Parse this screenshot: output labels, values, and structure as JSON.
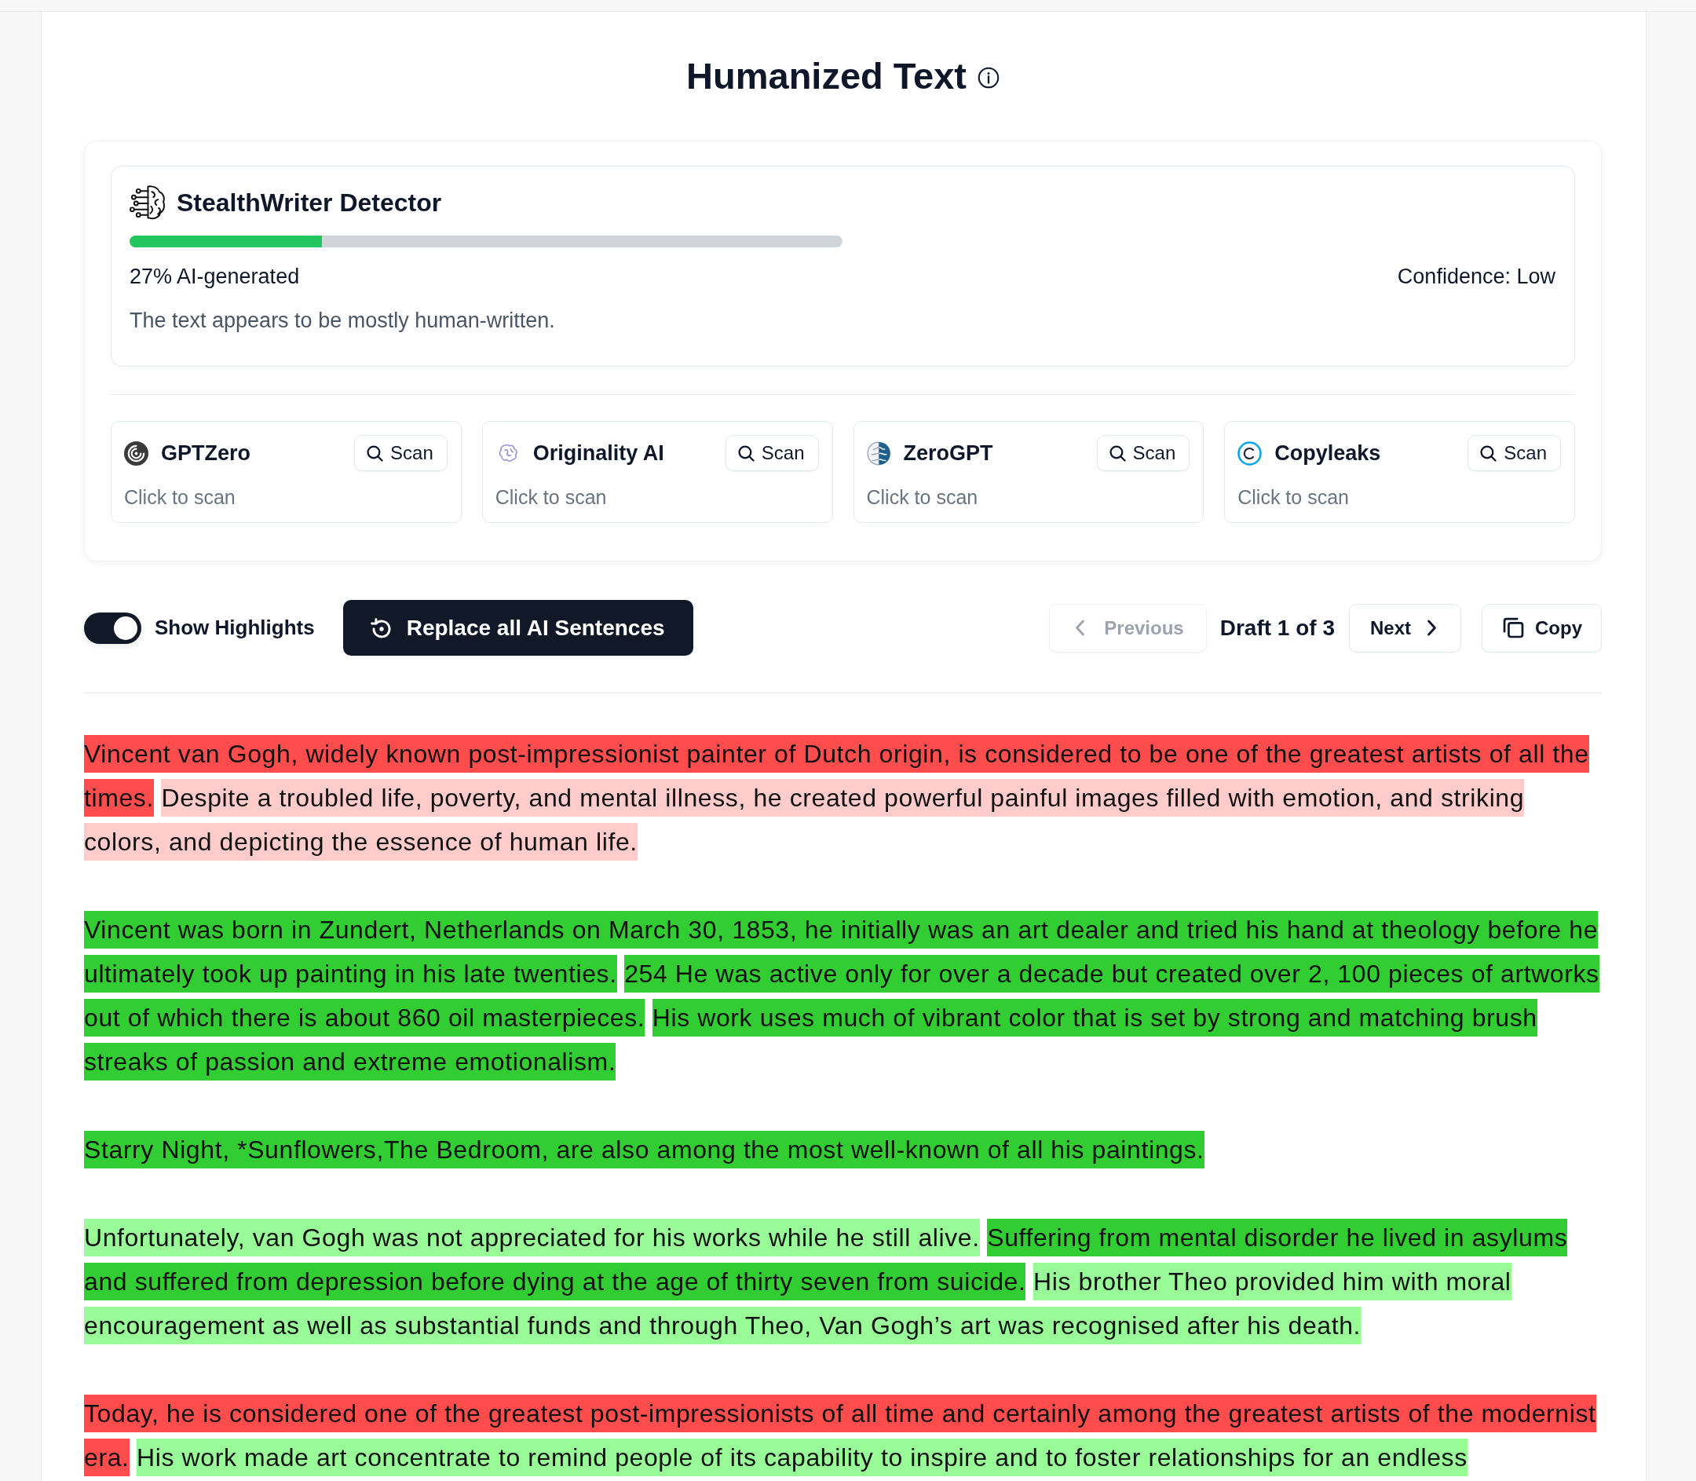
{
  "title": {
    "text": "Humanized Text"
  },
  "detector": {
    "name": "StealthWriter Detector",
    "level": 0.27,
    "score": "27% AI-generated",
    "confidence": "Confidence: Low",
    "summary": "The text appears to be mostly human-written."
  },
  "scanners": [
    {
      "name": "GPTZero",
      "button": "Scan",
      "status": "Click to scan"
    },
    {
      "name": "Originality AI",
      "button": "Scan",
      "status": "Click to scan"
    },
    {
      "name": "ZeroGPT",
      "button": "Scan",
      "status": "Click to scan"
    },
    {
      "name": "Copyleaks",
      "button": "Scan",
      "status": "Click to scan"
    }
  ],
  "toolbar": {
    "highlights_toggle": {
      "label": "Show Highlights",
      "on": true
    },
    "replace_button": {
      "label": "Replace all AI Sentences"
    },
    "previous_button": {
      "label": "Previous",
      "disabled": true
    },
    "draft": "Draft 1 of 3",
    "next_button": {
      "label": "Next",
      "disabled": false
    },
    "copy_button": {
      "label": "Copy"
    }
  },
  "paragraphs": [
    {
      "sentences": [
        {
          "text": "Vincent van Gogh, widely known post-impressionist painter of Dutch origin, is considered to be one of the greatest artists of all the times.",
          "color": "#ff4d4d"
        },
        {
          "text": "Despite a troubled life, poverty, and mental illness, he created powerful painful images filled with emotion, and striking colors, and depicting the essence of human life.",
          "color": "#ffcccb"
        }
      ]
    },
    {
      "sentences": [
        {
          "text": "Vincent was born in Zundert, Netherlands on March 30, 1853, he initially was an art dealer and tried his hand at theology before he ultimately took up painting in his late twenties.",
          "color": "#32cd32"
        },
        {
          "text": "254 He was active only for over a decade but created over 2, 100 pieces of artworks out of which there is about 860 oil masterpieces.",
          "color": "#32cd32"
        },
        {
          "text": "His work uses much of vibrant color that is set by strong and matching brush streaks of passion and extreme emotionalism.",
          "color": "#32cd32"
        }
      ]
    },
    {
      "sentences": [
        {
          "text": "Starry Night, *Sunflowers,The Bedroom, are also among the most well-known of all his paintings.",
          "color": "#32cd32"
        }
      ]
    },
    {
      "sentences": [
        {
          "text": "Unfortunately, van Gogh was not appreciated for his works while he still alive.",
          "color": "#98fb98"
        },
        {
          "text": "Suffering from mental disorder he lived in asylums and suffered from depression before dying at the age of thirty seven from suicide.",
          "color": "#32cd32"
        },
        {
          "text": "His brother Theo provided him with moral encouragement as well as substantial funds and through Theo, Van Gogh’s art was recognised after his death.",
          "color": "#98fb98"
        }
      ]
    },
    {
      "sentences": [
        {
          "text": "Today, he is considered one of the greatest post-impressionists of all time and certainly among the greatest artists of the modernist era.",
          "color": "#ff4d4d"
        },
        {
          "text": "His work made art concentrate to remind people of its capability to inspire and to foster relationships for an endless",
          "color": "#98fb98"
        }
      ]
    }
  ]
}
